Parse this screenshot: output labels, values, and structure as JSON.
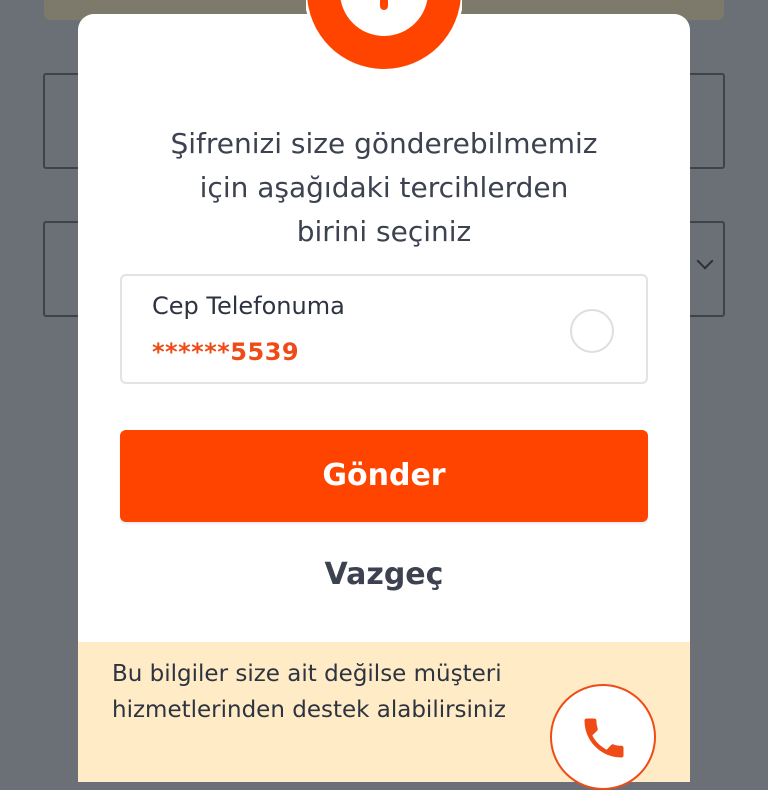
{
  "modal": {
    "message": "Şifrenizi size gönderebilmemiz\niçin aşağıdaki tercihlerden\nbirini seçiniz",
    "option": {
      "title": "Cep Telefonuma",
      "value": "******5539",
      "selected": false
    },
    "send_label": "Gönder",
    "cancel_label": "Vazgeç",
    "help": {
      "text": "Bu bilgiler size ait değilse müşteri hizmetlerinden destek alabilirsiniz",
      "call_icon": "phone-icon"
    },
    "alert_icon": "exclamation-icon"
  },
  "colors": {
    "accent": "#ff4400",
    "help_background": "#ffecc6",
    "overlay": "#6b7076"
  }
}
